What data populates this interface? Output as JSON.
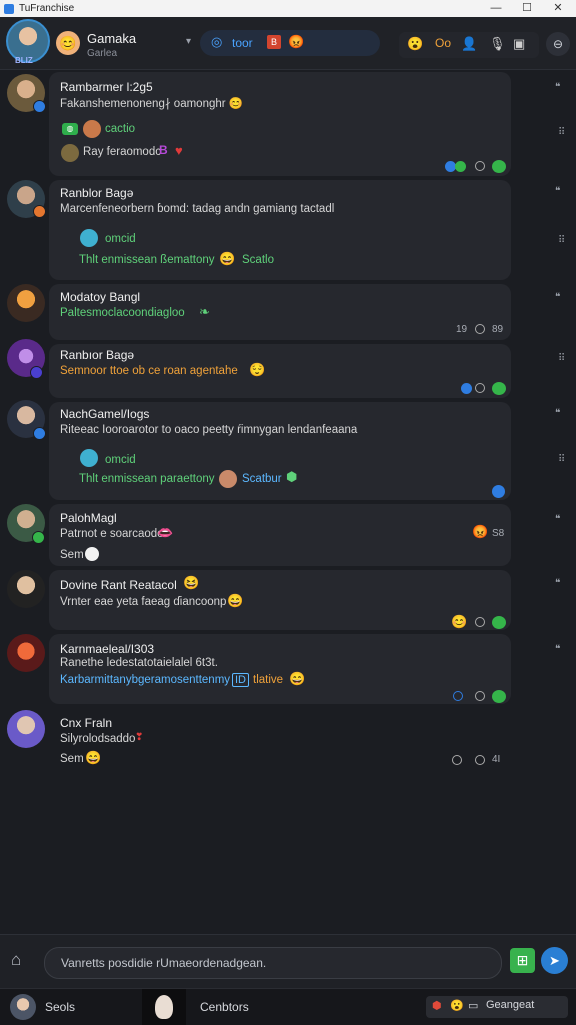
{
  "window": {
    "title": "TuFranchise",
    "controls": {
      "minimize": "—",
      "maximize": "☐",
      "close": "✕"
    }
  },
  "header": {
    "my_sub_label": "BLIZ",
    "chat_title": "Gamaka",
    "chat_subtitle": "Garlea",
    "pill_label": "toor",
    "pill_badge": "B",
    "tool_label": "Oo"
  },
  "colors": {
    "background": "#1b1d22",
    "card": "#26282e",
    "accent_blue": "#4aa3ff",
    "accent_green": "#5fd17a",
    "accent_orange": "#f0a23a"
  },
  "messages": [
    {
      "sender": "Rambarmer ⁠l:2g5",
      "lines": [
        "Fakanshemenoneng∤ oamonghr 😊"
      ],
      "chip_text": "cactio",
      "sub_line": "Ray feraomodc",
      "sub_badge": "B",
      "meta": ""
    },
    {
      "sender": "Ranblor Bagə",
      "lines": [
        "Marcenfeneorbern ɓomd: tadag andn gamiang tactadl"
      ],
      "chip_text": "omcid",
      "sub_line": "Thlt enmissean ßemattony",
      "sub_suffix": "Scatlo",
      "meta": ""
    },
    {
      "sender": "Modatoy Bangl",
      "lines": [
        "Paltesmoclacoondiagloo"
      ],
      "meta": "19",
      "meta2": "89"
    },
    {
      "sender": "Ranbıor Bagə",
      "lines": [
        "Semnoor ttoe  ob ce roan agentahe"
      ],
      "meta": ""
    },
    {
      "sender": "NachGamel/Iogs",
      "lines": [
        "Riteeac Iooroarotor to oaco peetty ŕimnygan lendanfeaana"
      ],
      "chip_text": "omcid",
      "sub_line": "Thlt enmissean paraettony",
      "sub_suffix": "Scatbur",
      "meta": ""
    },
    {
      "sender": "PalohMagl",
      "lines": [
        "Patrnot e soarcaodo:"
      ],
      "sub_line": "Sem",
      "meta": "S8"
    },
    {
      "sender": "Dovine Rant Reatacol",
      "lines": [
        "Vrnter eae yeta faeag ɗiancoonp"
      ],
      "meta": ""
    },
    {
      "sender": "Karnmaeleal/I303",
      "lines": [
        "Ranethe ledestatotaielalel 6t3t.",
        "Karbarmittanybgeramosenttenmy"
      ],
      "inline_tag": "ID",
      "inline_word": "tlative",
      "meta": ""
    },
    {
      "sender": "Cnx Fraln",
      "lines": [
        "Silyrolodsaddo"
      ],
      "sub_line": "Sem",
      "meta": "4I"
    }
  ],
  "composer": {
    "placeholder": "Vanretts posdidie rUmaeordenadgean."
  },
  "taskbar": {
    "label_1": "Seols",
    "label_2": "Cenbtors",
    "label_3": "Geangeat"
  }
}
